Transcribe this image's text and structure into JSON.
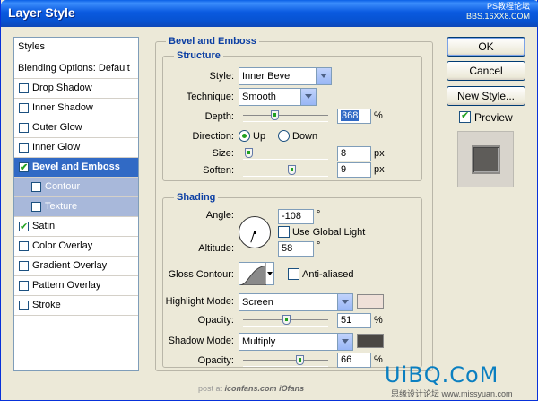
{
  "window": {
    "title": "Layer Style"
  },
  "watermark": {
    "line1": "PS教程论坛",
    "line2": "BBS.16XX8.COM"
  },
  "styles_list": {
    "header": "Styles",
    "blending": "Blending Options: Default",
    "items": [
      {
        "label": "Drop Shadow",
        "checked": false
      },
      {
        "label": "Inner Shadow",
        "checked": false
      },
      {
        "label": "Outer Glow",
        "checked": false
      },
      {
        "label": "Inner Glow",
        "checked": false
      },
      {
        "label": "Bevel and Emboss",
        "checked": true,
        "selected": true
      },
      {
        "label": "Contour",
        "checked": false,
        "sub": true
      },
      {
        "label": "Texture",
        "checked": false,
        "sub": true
      },
      {
        "label": "Satin",
        "checked": true
      },
      {
        "label": "Color Overlay",
        "checked": false
      },
      {
        "label": "Gradient Overlay",
        "checked": false
      },
      {
        "label": "Pattern Overlay",
        "checked": false
      },
      {
        "label": "Stroke",
        "checked": false
      }
    ]
  },
  "bevel": {
    "group_title": "Bevel and Emboss",
    "structure_title": "Structure",
    "style_label": "Style:",
    "style_value": "Inner Bevel",
    "technique_label": "Technique:",
    "technique_value": "Smooth",
    "depth_label": "Depth:",
    "depth_value": "368",
    "depth_unit": "%",
    "direction_label": "Direction:",
    "direction_up": "Up",
    "direction_down": "Down",
    "direction_selected": "Up",
    "size_label": "Size:",
    "size_value": "8",
    "size_unit": "px",
    "soften_label": "Soften:",
    "soften_value": "9",
    "soften_unit": "px"
  },
  "shading": {
    "title": "Shading",
    "angle_label": "Angle:",
    "angle_value": "-108",
    "angle_unit": "°",
    "global_light_label": "Use Global Light",
    "global_light_checked": false,
    "altitude_label": "Altitude:",
    "altitude_value": "58",
    "altitude_unit": "°",
    "gloss_label": "Gloss Contour:",
    "antialias_label": "Anti-aliased",
    "antialias_checked": false,
    "highlight_label": "Highlight Mode:",
    "highlight_value": "Screen",
    "highlight_color": "#efe0d8",
    "highlight_opacity_label": "Opacity:",
    "highlight_opacity": "51",
    "highlight_opacity_unit": "%",
    "shadow_label": "Shadow Mode:",
    "shadow_value": "Multiply",
    "shadow_color": "#4a4744",
    "shadow_opacity_label": "Opacity:",
    "shadow_opacity": "66",
    "shadow_opacity_unit": "%"
  },
  "buttons": {
    "ok": "OK",
    "cancel": "Cancel",
    "new_style": "New Style...",
    "preview": "Preview",
    "preview_checked": true
  },
  "footer": {
    "text": "post at",
    "site1": "iconfans.com",
    "site2": "iOfans"
  },
  "brand": {
    "text": "UiBQ.CoM",
    "cn": "思缘设计论坛 www.missyuan.com"
  }
}
